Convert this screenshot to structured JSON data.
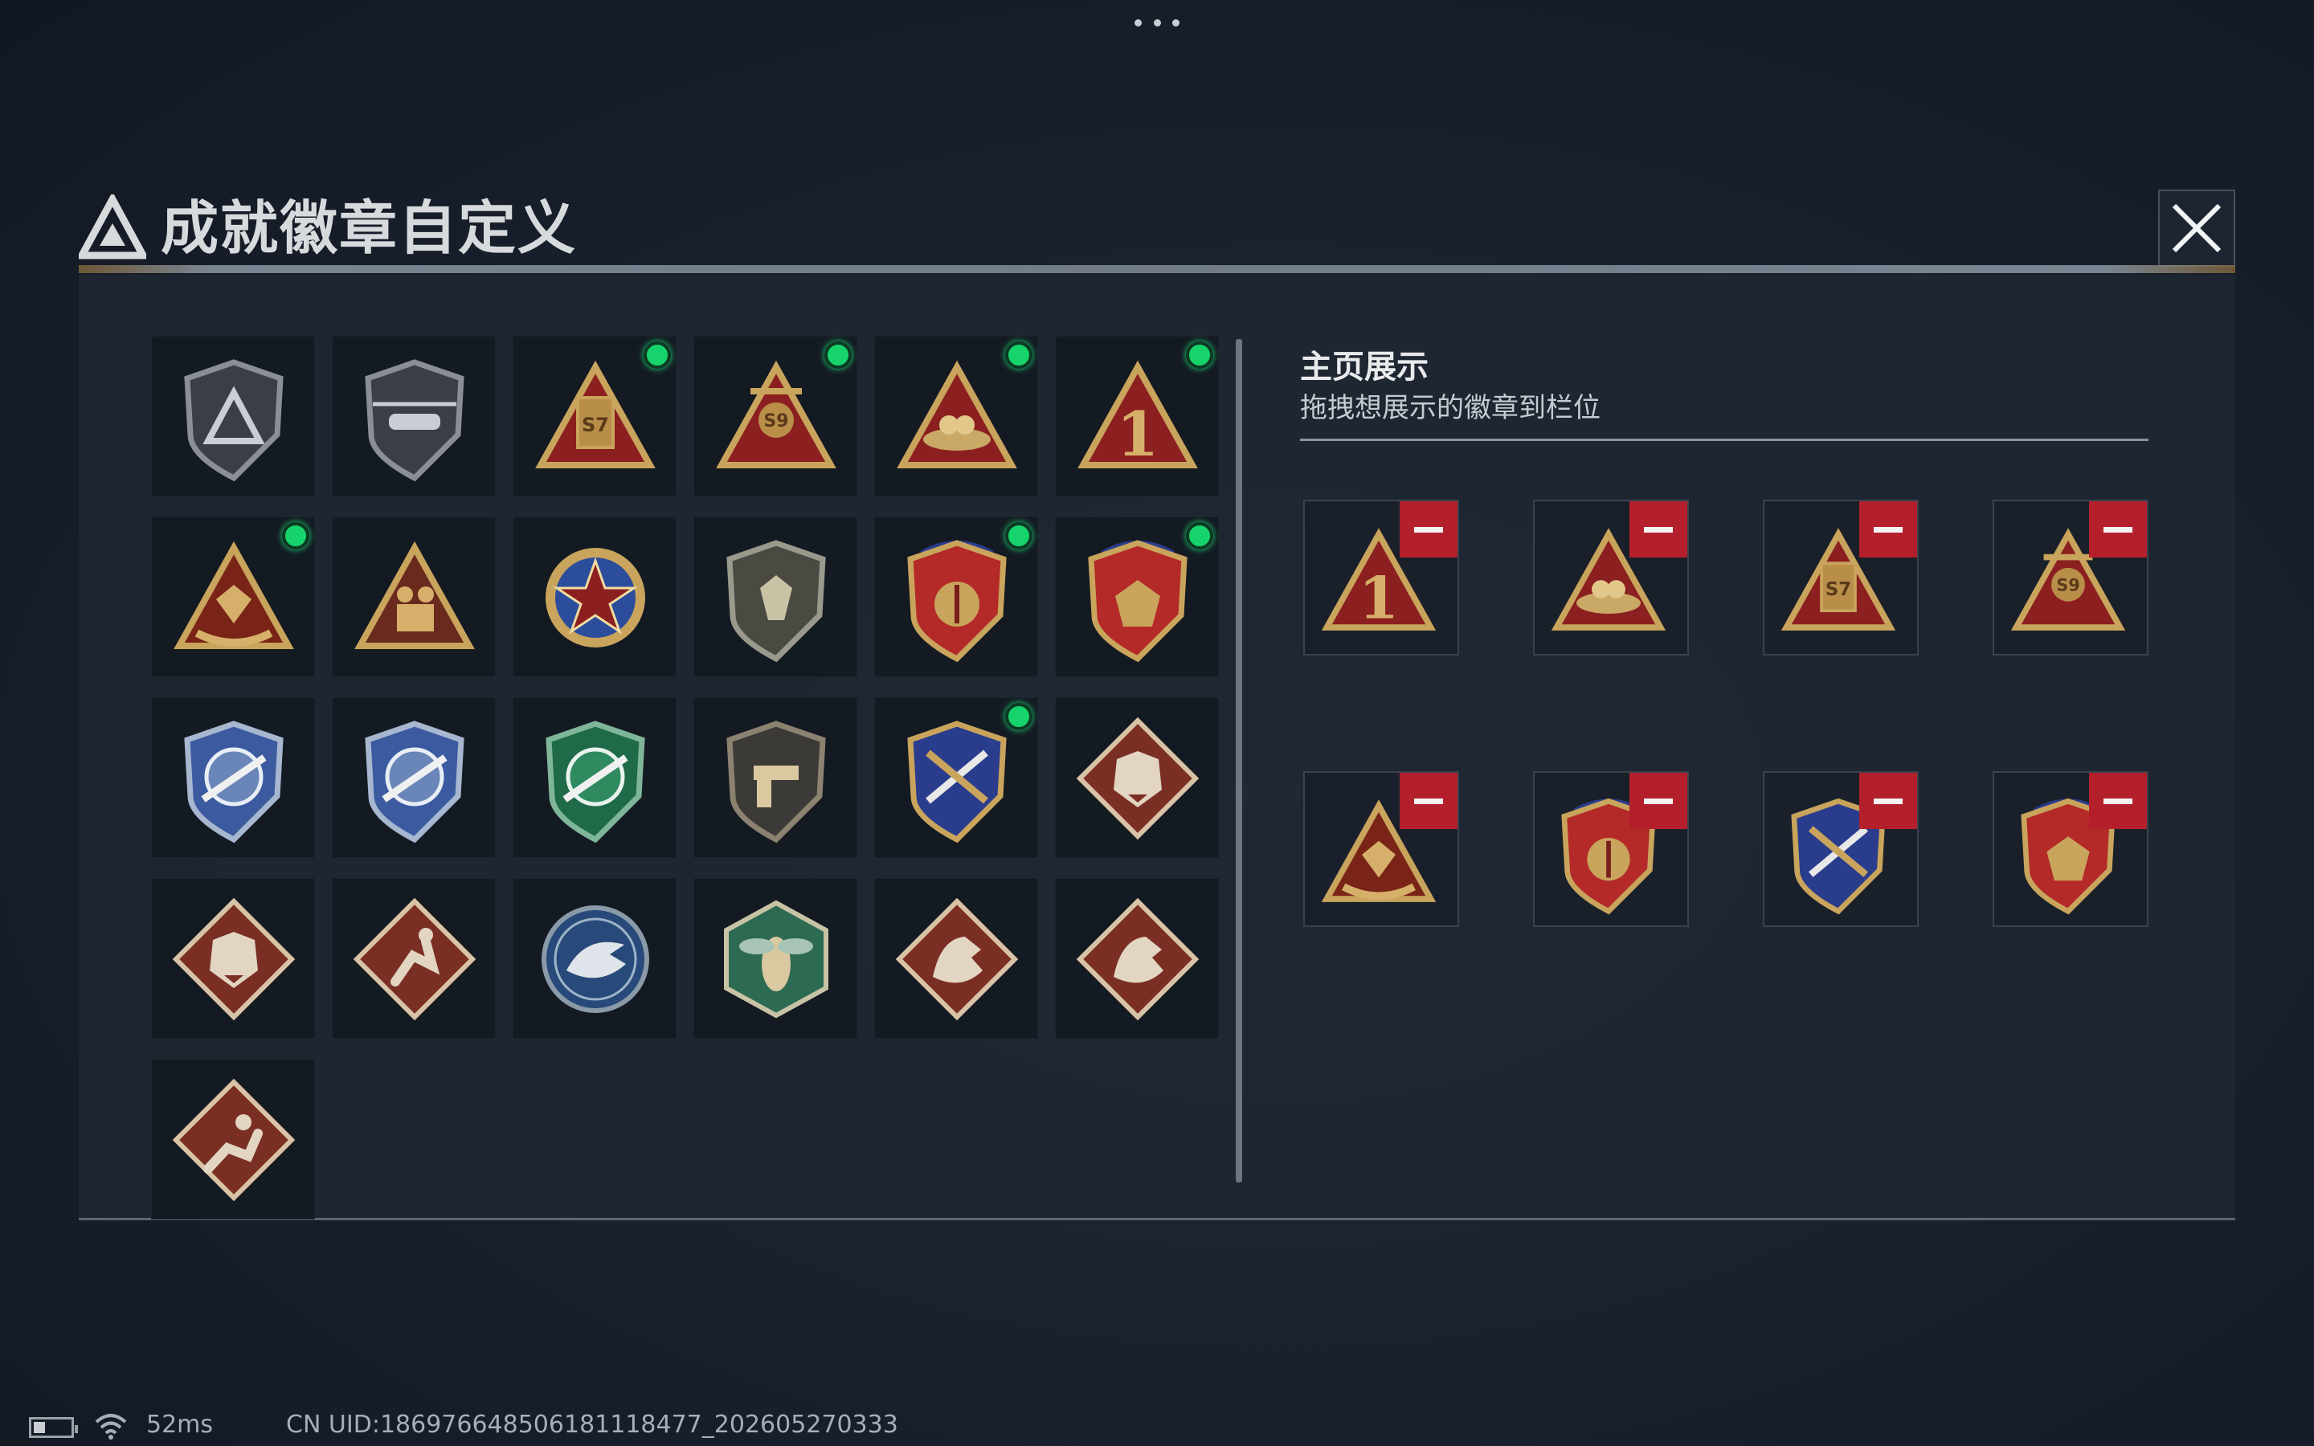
{
  "window": {
    "title": "成就徽章自定义",
    "close_icon": "close-icon"
  },
  "badge_grid": {
    "rows": [
      [
        {
          "icon": "triangle-emblem-badge",
          "new": false
        },
        {
          "icon": "helicopter-badge",
          "new": false
        },
        {
          "icon": "s7-season-badge",
          "new": true
        },
        {
          "icon": "s9-season-badge",
          "new": true
        },
        {
          "icon": "nest-triangle-badge",
          "new": true
        },
        {
          "icon": "number-one-badge",
          "new": true
        }
      ],
      [
        {
          "icon": "gem-hands-badge",
          "new": true
        },
        {
          "icon": "soldiers-triangle-badge",
          "new": false
        },
        {
          "icon": "star-medal-badge",
          "new": false
        },
        {
          "icon": "stone-shield-badge",
          "new": false
        },
        {
          "icon": "crest-shield-stars-badge",
          "new": true
        },
        {
          "icon": "gem-shield-stars-badge",
          "new": true
        }
      ],
      [
        {
          "icon": "rifle-scope-blue-badge",
          "new": false
        },
        {
          "icon": "rifle-scope-blue-badge-2",
          "new": false
        },
        {
          "icon": "rifle-scope-green-badge",
          "new": false
        },
        {
          "icon": "pistol-shield-badge",
          "new": false
        },
        {
          "icon": "crossed-weapons-gold-badge",
          "new": true
        },
        {
          "icon": "wolf-diamond-badge",
          "new": false
        }
      ],
      [
        {
          "icon": "wolf-diamond-badge-2",
          "new": false
        },
        {
          "icon": "runner-diamond-badge",
          "new": false
        },
        {
          "icon": "eagle-circle-badge",
          "new": false
        },
        {
          "icon": "wasp-hexagon-badge",
          "new": false
        },
        {
          "icon": "dragon-diamond-badge",
          "new": false
        },
        {
          "icon": "dragon-diamond-badge-2",
          "new": false
        }
      ],
      [
        {
          "icon": "sprinter-diamond-badge",
          "new": false
        }
      ]
    ]
  },
  "showcase": {
    "title": "主页展示",
    "subtitle": "拖拽想展示的徽章到栏位",
    "slots": [
      {
        "icon": "number-one-badge",
        "remove_icon": "minus-icon"
      },
      {
        "icon": "nest-triangle-badge",
        "remove_icon": "minus-icon"
      },
      {
        "icon": "s7-season-badge",
        "remove_icon": "minus-icon"
      },
      {
        "icon": "s9-season-badge",
        "remove_icon": "minus-icon"
      },
      {
        "icon": "gem-hands-badge",
        "remove_icon": "minus-icon"
      },
      {
        "icon": "crest-shield-stars-badge",
        "remove_icon": "minus-icon"
      },
      {
        "icon": "crossed-weapons-gold-badge",
        "remove_icon": "minus-icon"
      },
      {
        "icon": "gem-shield-stars-badge",
        "remove_icon": "minus-icon"
      }
    ]
  },
  "status_bar": {
    "ping": "52ms",
    "uid": "CN UID:18697664850618111847​7_202605270333"
  },
  "colors": {
    "new_dot": "#16d46b",
    "remove_button": "#b3202c",
    "gold": "#c9a45c",
    "red": "#8c1f1f"
  }
}
